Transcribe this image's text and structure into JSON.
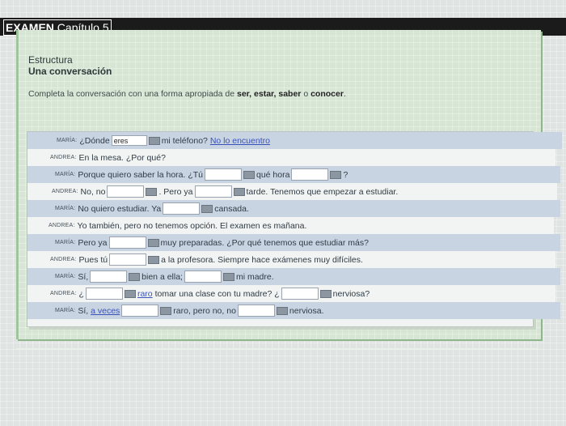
{
  "header": {
    "title_bold": "EXAMEN",
    "title_rest": " Capítulo 5"
  },
  "section": {
    "title": "Estructura",
    "subtitle": "Una conversación"
  },
  "instructions": {
    "text_a": "Completa la conversación con una forma apropiada de ",
    "verbs": "ser, estar, saber",
    "text_b": " o ",
    "verb_last": "conocer",
    "text_c": "."
  },
  "rows": [
    {
      "speaker": "MARÍA:",
      "p1": "¿Dónde",
      "gap1": "eres",
      "p2": "mi teléfono?",
      "link": "No lo encuentro"
    },
    {
      "speaker": "ANDREA:",
      "p1": "En la mesa. ¿Por qué?"
    },
    {
      "speaker": "MARÍA:",
      "p1": "Porque quiero saber la hora. ¿Tú",
      "p2": "qué hora",
      "p3": "?"
    },
    {
      "speaker": "ANDREA:",
      "p1": "No, no",
      "p2": ". Pero ya",
      "p3": "tarde. Tenemos que empezar a estudiar."
    },
    {
      "speaker": "MARÍA:",
      "p1": "No quiero estudiar. Ya",
      "p2": "cansada."
    },
    {
      "speaker": "ANDREA:",
      "p1": "Yo también, pero no tenemos opción. El examen es mañana."
    },
    {
      "speaker": "MARÍA:",
      "p1": "Pero ya",
      "p2": "muy preparadas. ¿Por qué tenemos que estudiar más?"
    },
    {
      "speaker": "ANDREA:",
      "p1": "Pues tú",
      "p2": "a la profesora. Siempre hace exámenes muy difíciles."
    },
    {
      "speaker": "MARÍA:",
      "p1": "Sí,",
      "p2": "bien a ella;",
      "p3": "mi madre."
    },
    {
      "speaker": "ANDREA:",
      "p1": "¿",
      "link": "raro",
      "p2": "tomar una clase con tu madre? ¿",
      "p3": "nerviosa?"
    },
    {
      "speaker": "MARÍA:",
      "p1": "Sí,",
      "link": "a veces",
      "p2": "raro, pero no, no",
      "p3": "nerviosa."
    }
  ]
}
